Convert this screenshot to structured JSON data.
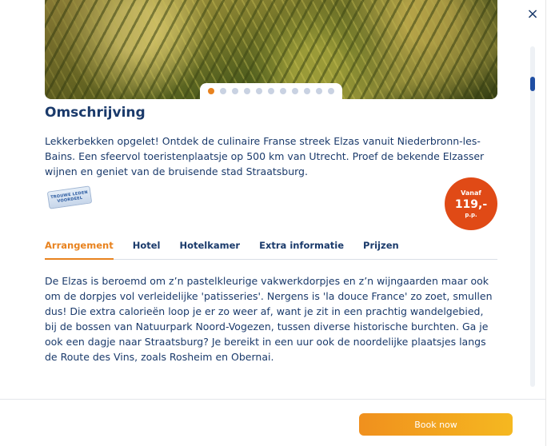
{
  "hero": {
    "image_alt": "vineyard",
    "slide_count": 11,
    "active_slide": 1
  },
  "close": {
    "icon": "×"
  },
  "description": {
    "heading": "Omschrijving",
    "text": "Lekkerbekken opgelet! Ontdek de culinaire Franse streek Elzas vanuit Niederbronn-les-Bains. Een sfeervol toeristenplaatsje op 500 km van Utrecht. Proef de bekende Elzasser wijnen en geniet van de bruisende stad Straatsburg."
  },
  "badge": {
    "line1": "TROUWE LEDEN",
    "line2": "VOORDEEL"
  },
  "price": {
    "from": "Vanaf",
    "amount": "119,-",
    "unit": "p.p."
  },
  "tabs": [
    "Arrangement",
    "Hotel",
    "Hotelkamer",
    "Extra informatie",
    "Prijzen"
  ],
  "active_tab": "Arrangement",
  "arrangement": {
    "text": "De Elzas is beroemd om z’n pastelkleurige vakwerkdorpjes en z’n wijngaarden maar ook om de dorpjes vol verleidelijke 'patisseries'. Nergens is 'la douce France' zo zoet, smullen dus! Die extra calorieën loop je er zo weer af, want je zit in een prachtig wandelgebied, bij de bossen van Natuurpark Noord-Vogezen, tussen diverse historische burchten. Ga je ook een dagje naar Straatsburg? Je bereikt in een uur ook de noordelijke plaatsjes langs de Route des Vins, zoals Rosheim en Obernai."
  },
  "footer": {
    "book_label": "Book now"
  },
  "colors": {
    "accent": "#e8821e",
    "price_bg": "#e04a16",
    "text": "#1a3a6b"
  }
}
